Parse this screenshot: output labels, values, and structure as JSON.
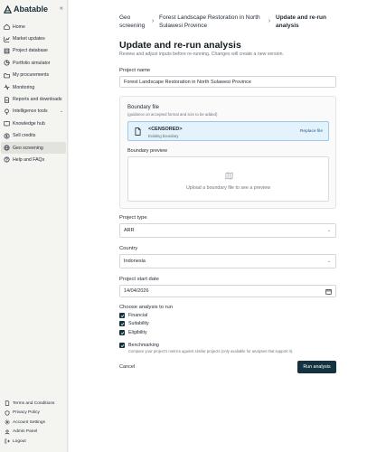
{
  "app": {
    "name": "Abatable"
  },
  "sidebar": {
    "collapse_label": "«",
    "items": [
      {
        "label": "Home",
        "icon": "home-icon"
      },
      {
        "label": "Market updates",
        "icon": "chart-icon"
      },
      {
        "label": "Project database",
        "icon": "database-icon"
      },
      {
        "label": "Portfolio simulator",
        "icon": "pie-icon"
      },
      {
        "label": "My procurements",
        "icon": "folder-icon"
      },
      {
        "label": "Monitoring",
        "icon": "monitor-icon"
      },
      {
        "label": "Reports and downloads",
        "icon": "report-icon"
      },
      {
        "label": "Intelligence tools",
        "icon": "bulb-icon"
      },
      {
        "label": "Knowledge hub",
        "icon": "book-icon"
      },
      {
        "label": "Sell credits",
        "icon": "dollar-icon"
      },
      {
        "label": "Geo screening",
        "icon": "globe-icon"
      },
      {
        "label": "Help and FAQs",
        "icon": "help-icon"
      }
    ],
    "footer": [
      {
        "label": "Terms and Conditions",
        "icon": "doc-icon"
      },
      {
        "label": "Privacy Policy",
        "icon": "shield-icon"
      },
      {
        "label": "Account Settings",
        "icon": "gear-icon"
      },
      {
        "label": "Admin Panel",
        "icon": "admin-icon"
      },
      {
        "label": "Logout",
        "icon": "logout-icon"
      }
    ]
  },
  "breadcrumb": {
    "items": [
      "Geo screening",
      "Forest Landscape Restoration in North Sulawesi Province",
      "Update and re-run analysis"
    ]
  },
  "page": {
    "title": "Update and re-run analysis",
    "subtitle": "Review and adjust inputs before re-running. Changes will create a new version."
  },
  "form": {
    "project_name_label": "Project name",
    "project_name_value": "Forest Landscape Restoration in North Sulawesi Province",
    "boundary": {
      "title": "Boundary file",
      "help": "(guidance on accepted format and size to be added)",
      "file_name": "<CENSORED>",
      "file_status": "Existing boundary",
      "replace_label": "Replace file",
      "preview_title": "Boundary preview",
      "preview_placeholder": "Upload a boundary file to see a preview"
    },
    "project_type_label": "Project type",
    "project_type_value": "ARR",
    "country_label": "Country",
    "country_value": "Indonesia",
    "start_date_label": "Project start date",
    "start_date_value": "14/04/2026",
    "analysis_label": "Choose analysis to run",
    "analyses": [
      "Financial",
      "Suitability",
      "Eligibility"
    ],
    "benchmarking_label": "Benchmarking",
    "benchmarking_desc": "Compare your project's metrics against similar projects (only available for analyses that support it).",
    "cancel_label": "Cancel",
    "run_label": "Run analysis"
  },
  "colors": {
    "primary": "#14323f",
    "accent_bg": "#e3f2fb",
    "accent_border": "#9ec9e6"
  }
}
